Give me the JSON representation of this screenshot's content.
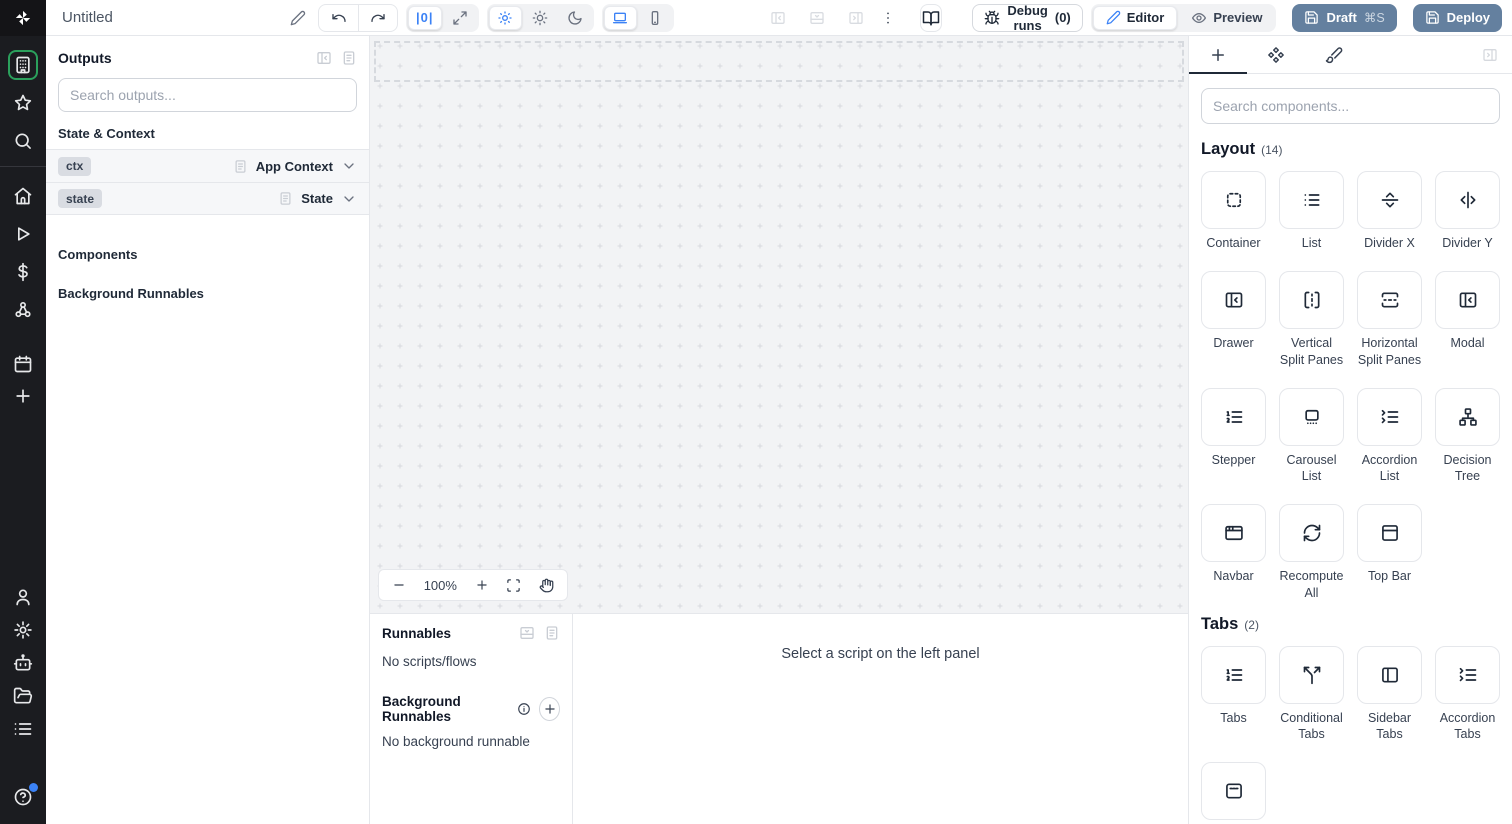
{
  "topbar": {
    "title": "Untitled",
    "zoom_reset_label": "|0|",
    "debug_runs_label": "Debug runs",
    "debug_runs_count": "(0)",
    "editor_label": "Editor",
    "preview_label": "Preview",
    "draft_label": "Draft",
    "draft_shortcut": "⌘S",
    "deploy_label": "Deploy"
  },
  "rail": {
    "top": [
      {
        "icon": "building",
        "active": true
      },
      {
        "icon": "star"
      },
      {
        "icon": "search"
      }
    ],
    "middle": [
      {
        "icon": "home"
      },
      {
        "icon": "play"
      },
      {
        "icon": "dollar"
      },
      {
        "icon": "resources"
      }
    ],
    "lower": [
      {
        "icon": "calendar"
      },
      {
        "icon": "plus"
      }
    ],
    "bottom": [
      {
        "icon": "user"
      },
      {
        "icon": "gear"
      },
      {
        "icon": "bot"
      },
      {
        "icon": "folder-open"
      },
      {
        "icon": "list"
      }
    ],
    "help_icon": "help"
  },
  "outputs_panel": {
    "title": "Outputs",
    "search_placeholder": "Search outputs...",
    "state_context_title": "State & Context",
    "components_title": "Components",
    "background_runnables_title": "Background Runnables",
    "rows": [
      {
        "badge": "ctx",
        "type": "App Context"
      },
      {
        "badge": "state",
        "type": "State"
      }
    ]
  },
  "canvas": {
    "zoom_level": "100%"
  },
  "runnables_panel": {
    "title": "Runnables",
    "empty_text": "No scripts/flows",
    "background_title": "Background Runnables",
    "background_empty_text": "No background runnable",
    "detail_placeholder": "Select a script on the left panel"
  },
  "components_panel": {
    "search_placeholder": "Search components...",
    "sections": [
      {
        "title": "Layout",
        "count": "(14)",
        "items": [
          {
            "label": "Container",
            "icon": "container"
          },
          {
            "label": "List",
            "icon": "list-lines"
          },
          {
            "label": "Divider X",
            "icon": "divider-x"
          },
          {
            "label": "Divider Y",
            "icon": "divider-y"
          },
          {
            "label": "Drawer",
            "icon": "panel-left-close"
          },
          {
            "label": "Vertical Split Panes",
            "icon": "vsplit"
          },
          {
            "label": "Horizontal Split Panes",
            "icon": "hsplit"
          },
          {
            "label": "Modal",
            "icon": "panel-left-close"
          },
          {
            "label": "Stepper",
            "icon": "list-ordered"
          },
          {
            "label": "Carousel List",
            "icon": "carousel"
          },
          {
            "label": "Accordion List",
            "icon": "list-collapse"
          },
          {
            "label": "Decision Tree",
            "icon": "network"
          },
          {
            "label": "Navbar",
            "icon": "app-window"
          },
          {
            "label": "Recompute All",
            "icon": "refresh"
          },
          {
            "label": "Top Bar",
            "icon": "panel-top"
          }
        ]
      },
      {
        "title": "Tabs",
        "count": "(2)",
        "items": [
          {
            "label": "Tabs",
            "icon": "list-ordered"
          },
          {
            "label": "Conditional Tabs",
            "icon": "split"
          },
          {
            "label": "Sidebar Tabs",
            "icon": "panel-left"
          },
          {
            "label": "Accordion Tabs",
            "icon": "list-collapse"
          },
          {
            "label": "",
            "icon": "window-dashed"
          }
        ]
      }
    ]
  },
  "colors": {
    "accent_blue": "#3b82f6",
    "brand_green": "#2ba05c",
    "deploy_button": "#64809f",
    "rail_background": "#1b1c20",
    "canvas_background": "#f2f3f5"
  }
}
